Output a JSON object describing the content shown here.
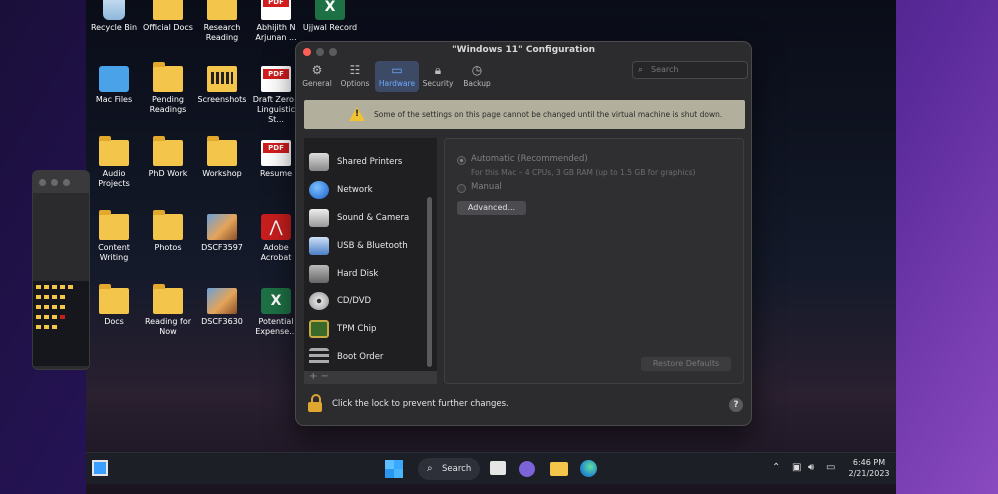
{
  "desktop": {
    "icons": [
      {
        "label": "Recycle Bin",
        "type": "recycle"
      },
      {
        "label": "Official Docs",
        "type": "folder"
      },
      {
        "label": "Research Reading",
        "type": "folder"
      },
      {
        "label": "Abhijith N Arjunan ...",
        "type": "pdf"
      },
      {
        "label": "Ujjwal Record",
        "type": "excel"
      },
      {
        "label": "Mac Files",
        "type": "macfolder"
      },
      {
        "label": "Pending Readings",
        "type": "folder"
      },
      {
        "label": "Screenshots",
        "type": "screens"
      },
      {
        "label": "Draft Zero - Linguistic St...",
        "type": "pdf"
      },
      {
        "label": "Audio Projects",
        "type": "folder"
      },
      {
        "label": "PhD Work",
        "type": "folder"
      },
      {
        "label": "Workshop",
        "type": "folder"
      },
      {
        "label": "Resume",
        "type": "pdf"
      },
      {
        "label": "Content Writing",
        "type": "folder"
      },
      {
        "label": "Photos",
        "type": "folder"
      },
      {
        "label": "DSCF3597",
        "type": "photo"
      },
      {
        "label": "Adobe Acrobat",
        "type": "acrobat"
      },
      {
        "label": "Docs",
        "type": "folder"
      },
      {
        "label": "Reading for Now",
        "type": "folder"
      },
      {
        "label": "DSCF3630",
        "type": "photo"
      },
      {
        "label": "Potential Expense...",
        "type": "excel"
      }
    ],
    "pdf_badge": "PDF",
    "excel_badge": "X"
  },
  "dialog": {
    "title": "\"Windows 11\" Configuration",
    "toolbar": [
      {
        "label": "General",
        "icon": "gear-icon"
      },
      {
        "label": "Options",
        "icon": "sliders-icon"
      },
      {
        "label": "Hardware",
        "icon": "monitor-icon",
        "active": true
      },
      {
        "label": "Security",
        "icon": "lock-icon"
      },
      {
        "label": "Backup",
        "icon": "clock-icon"
      }
    ],
    "search_placeholder": "Search",
    "warning": "Some of the settings on this page cannot be changed until the virtual machine is shut down.",
    "hardware_items": [
      {
        "label": "Shared Printers",
        "icon": "printer-icon"
      },
      {
        "label": "Network",
        "icon": "globe-icon"
      },
      {
        "label": "Sound & Camera",
        "icon": "speaker-icon"
      },
      {
        "label": "USB & Bluetooth",
        "icon": "usb-icon"
      },
      {
        "label": "Hard Disk",
        "icon": "harddisk-icon"
      },
      {
        "label": "CD/DVD",
        "icon": "disc-icon"
      },
      {
        "label": "TPM Chip",
        "icon": "chip-icon"
      },
      {
        "label": "Boot Order",
        "icon": "boot-order-icon"
      }
    ],
    "list_footer": "+ −",
    "cpu_memory": {
      "automatic_label": "Automatic (Recommended)",
      "automatic_detail": "For this Mac – 4 CPUs, 3 GB RAM (up to 1.5 GB for graphics)",
      "manual_label": "Manual",
      "advanced_button": "Advanced...",
      "restore_button": "Restore Defaults"
    },
    "lock_text": "Click the lock to prevent further changes.",
    "help_label": "?"
  },
  "taskbar": {
    "search_label": "Search",
    "time": "6:46 PM",
    "date": "2/21/2023"
  }
}
